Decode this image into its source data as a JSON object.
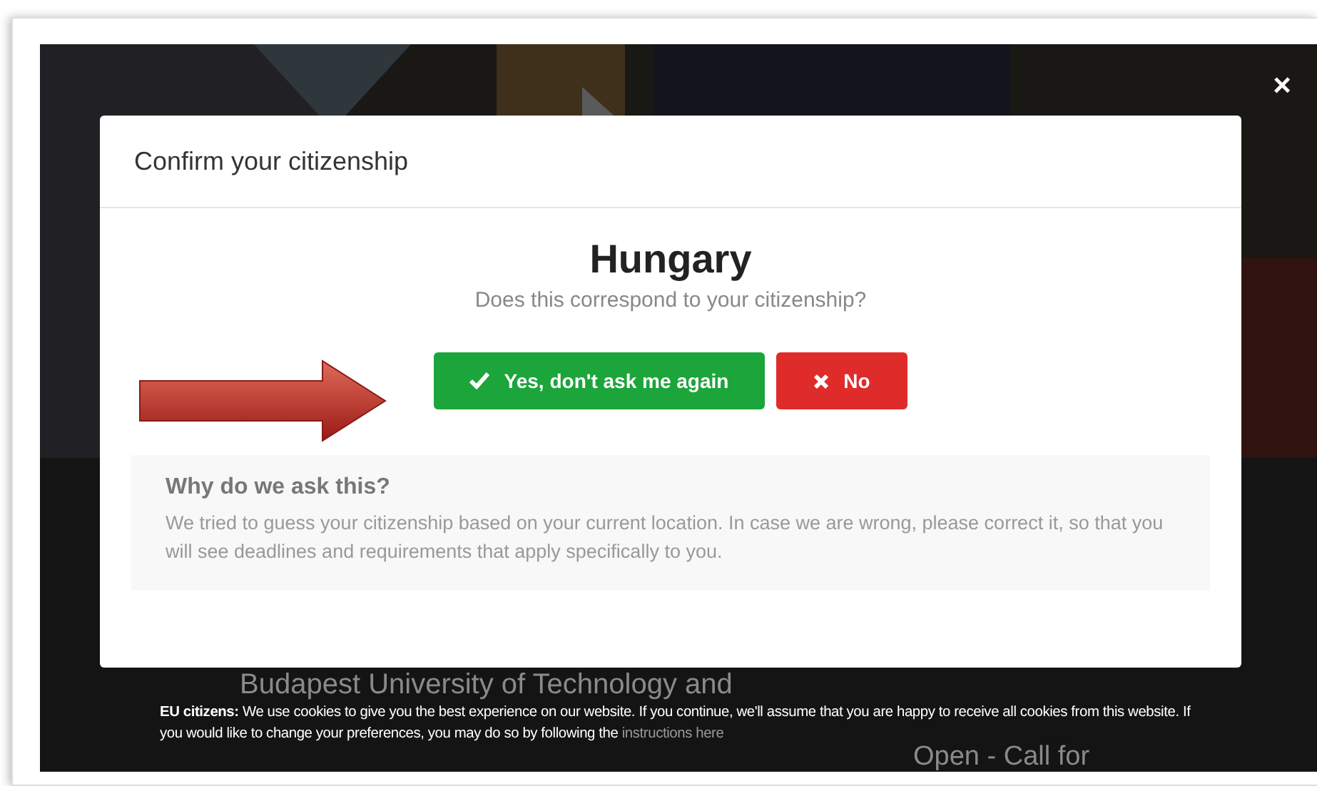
{
  "background": {
    "heading": "Budapest University of Technology and",
    "side_heading": "Open - Call for"
  },
  "modal": {
    "title": "Confirm your citizenship",
    "country": "Hungary",
    "question": "Does this correspond to your citizenship?",
    "buttons": [
      {
        "kind": "confirm",
        "label": "Yes, don't ask me again"
      },
      {
        "kind": "decline",
        "label": "No"
      }
    ],
    "info": {
      "title": "Why do we ask this?",
      "text": "We tried to guess your citizenship based on your current location. In case we are wrong, please correct it, so that you will see deadlines and requirements that apply specifically to you."
    }
  },
  "close": "×",
  "cookie_banner": {
    "text": "**EU citizens:** We use cookies to give you the best experience on our website. If you continue, we'll assume that you are happy to receive all cookies from this website. If you would like to change your preferences, you may do so by following the",
    "link": "instructions here"
  }
}
